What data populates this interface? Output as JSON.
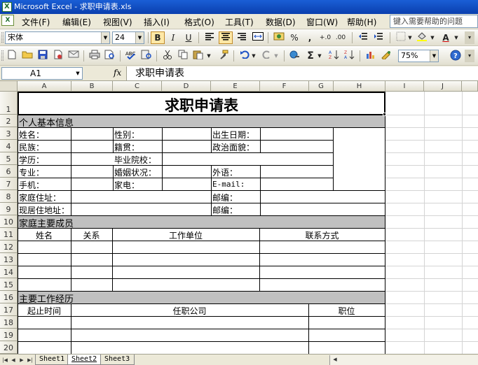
{
  "window": {
    "title": "Microsoft Excel - 求职申请表.xls"
  },
  "menu": {
    "items": [
      "文件(F)",
      "编辑(E)",
      "视图(V)",
      "插入(I)",
      "格式(O)",
      "工具(T)",
      "数据(D)",
      "窗口(W)",
      "帮助(H)"
    ],
    "help_placeholder": "键入需要帮助的问题"
  },
  "toolbar_format": {
    "font": "宋体",
    "size": "24",
    "bold": "B",
    "italic": "I",
    "underline": "U",
    "percent": "%",
    "comma": ",",
    "inc_dec": "+.0",
    "dec_dec": ".00",
    "font_color_label": "A"
  },
  "toolbar_standard": {
    "sigma": "Σ",
    "zoom": "75%"
  },
  "formula_bar": {
    "cell_ref": "A1",
    "fx": "fx",
    "content": "求职申请表"
  },
  "columns": [
    "A",
    "B",
    "C",
    "D",
    "E",
    "F",
    "G",
    "H",
    "I",
    "J"
  ],
  "rows": [
    "1",
    "2",
    "3",
    "4",
    "5",
    "6",
    "7",
    "8",
    "9",
    "10",
    "11",
    "12",
    "13",
    "14",
    "15",
    "16",
    "17",
    "18",
    "19",
    "20"
  ],
  "sheet": {
    "title": "求职申请表",
    "section_personal": "个人基本信息",
    "name": "姓名：",
    "gender": "性别：",
    "birth": "出生日期：",
    "ethnicity": "民族：",
    "native_place": "籍贯：",
    "political": "政治面貌：",
    "education": "学历：",
    "school": "毕业院校：",
    "major": "专业：",
    "marital": "婚姻状况：",
    "language": "外语：",
    "mobile": "手机：",
    "home_phone": "家电：",
    "email": "E-mail:",
    "home_address": "家庭住址：",
    "postcode1": "邮编：",
    "current_address": "现居住地址：",
    "postcode2": "邮编：",
    "section_family": "家庭主要成员",
    "family_headers": [
      "姓名",
      "关系",
      "工作单位",
      "联系方式"
    ],
    "section_work": "主要工作经历",
    "work_headers": [
      "起止时间",
      "任职公司",
      "职位"
    ]
  },
  "tabs": [
    "Sheet1",
    "Sheet2",
    "Sheet3"
  ],
  "active_tab": "Sheet2"
}
